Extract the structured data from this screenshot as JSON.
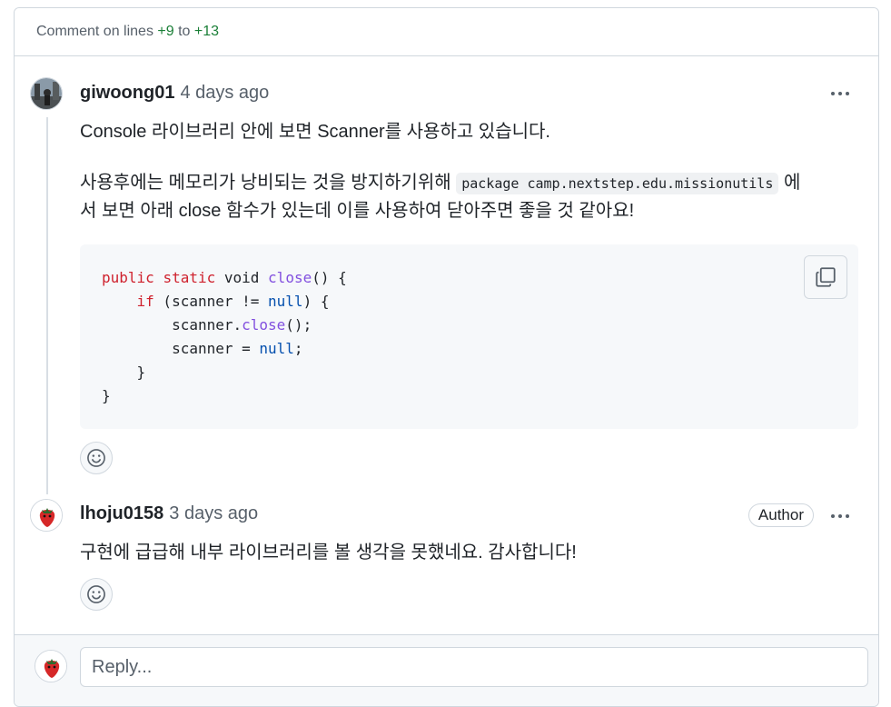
{
  "header": {
    "prefix": "Comment on lines",
    "line_start": "+9",
    "to": "to",
    "line_end": "+13"
  },
  "comments": [
    {
      "author": "giwoong01",
      "time": "4 days ago",
      "para1": "Console 라이브러리 안에 보면 Scanner를 사용하고 있습니다.",
      "para2_before": "사용후에는 메모리가 낭비되는 것을 방지하기위해",
      "inline_code": "package camp.nextstep.edu.missionutils",
      "para2_after_1": "에",
      "para2_after_2": "서 보면 아래 close 함수가 있는데 이를 사용하여 닫아주면 좋을 것 같아요!",
      "code": {
        "l1_kw1": "public",
        "l1_kw2": "static",
        "l1_type": "void",
        "l1_fn": "close",
        "l1_tail": "() {",
        "l2_kw": "if",
        "l2_mid": " (scanner != ",
        "l2_null": "null",
        "l2_tail": ") {",
        "l3_obj": "scanner.",
        "l3_fn": "close",
        "l3_tail": "();",
        "l4_mid": "scanner = ",
        "l4_null": "null",
        "l4_tail": ";",
        "l5": "}",
        "l6": "}"
      }
    },
    {
      "author": "lhoju0158",
      "time": "3 days ago",
      "badge": "Author",
      "text": "구현에 급급해 내부 라이브러리를 볼 생각을 못했네요. 감사합니다!"
    }
  ],
  "reply": {
    "placeholder": "Reply..."
  },
  "icons": {
    "copy": "copy-icon",
    "more": "kebab-horizontal-icon",
    "reaction": "smiley-icon"
  },
  "colors": {
    "line_number_green": "#1a7f37",
    "keyword": "#cf222e",
    "function": "#8250df",
    "constant": "#0550ae"
  }
}
